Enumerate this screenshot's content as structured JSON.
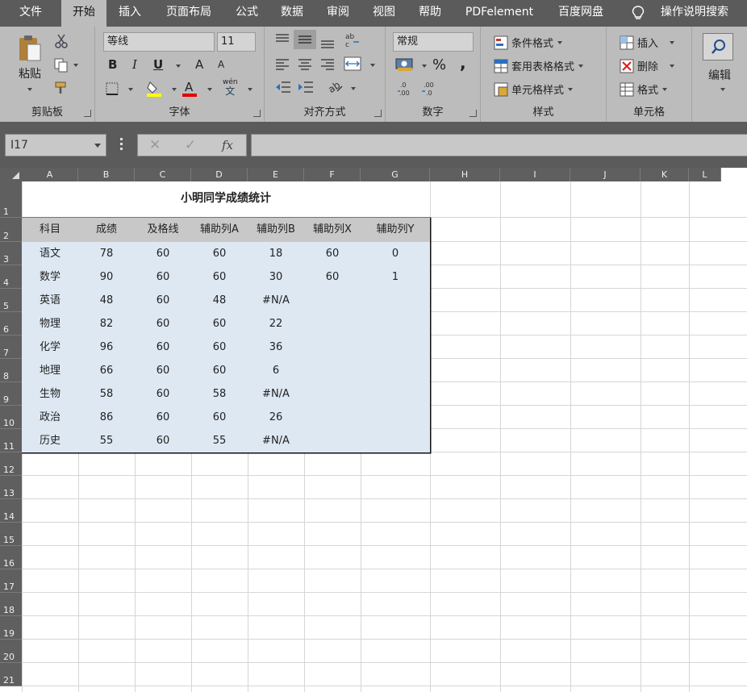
{
  "menu": {
    "tabs": [
      "文件",
      "开始",
      "插入",
      "页面布局",
      "公式",
      "数据",
      "审阅",
      "视图",
      "帮助",
      "PDFelement",
      "百度网盘"
    ],
    "active_tab": "开始",
    "search_label": "操作说明搜索"
  },
  "ribbon": {
    "clipboard": {
      "label": "剪贴板",
      "paste": "粘贴"
    },
    "font": {
      "label": "字体",
      "font_name": "等线",
      "font_size": "11",
      "bold": "B",
      "italic": "I",
      "underline": "U",
      "grow": "A",
      "shrink": "A",
      "phonetic_top": "wén",
      "phonetic_bottom": "文",
      "highlight_color": "#ffff00",
      "font_color": "#e00000"
    },
    "alignment": {
      "label": "对齐方式"
    },
    "number": {
      "label": "数字",
      "format": "常规",
      "percent": "%",
      "comma": ","
    },
    "styles": {
      "label": "样式",
      "conditional": "条件格式",
      "table_format": "套用表格格式",
      "cell_styles": "单元格样式"
    },
    "cells": {
      "label": "单元格",
      "insert": "插入",
      "delete": "删除",
      "format": "格式"
    },
    "editing": {
      "label": "编辑"
    }
  },
  "formula_bar": {
    "name_box": "I17",
    "cancel": "✕",
    "confirm": "✓",
    "fx": "fx",
    "formula": ""
  },
  "sheet": {
    "columns": [
      "A",
      "B",
      "C",
      "D",
      "E",
      "F",
      "G",
      "H",
      "I",
      "J",
      "K",
      "L"
    ],
    "rows": [
      "1",
      "2",
      "3",
      "4",
      "5",
      "6",
      "7",
      "8",
      "9",
      "10",
      "11",
      "12",
      "13",
      "14",
      "15",
      "16",
      "17",
      "18",
      "19",
      "20",
      "21"
    ],
    "title": "小明同学成绩统计",
    "headers": [
      "科目",
      "成绩",
      "及格线",
      "辅助列A",
      "辅助列B",
      "辅助列X",
      "辅助列Y"
    ],
    "data": [
      [
        "语文",
        "78",
        "60",
        "60",
        "18",
        "60",
        "0"
      ],
      [
        "数学",
        "90",
        "60",
        "60",
        "30",
        "60",
        "1"
      ],
      [
        "英语",
        "48",
        "60",
        "48",
        "#N/A",
        "",
        ""
      ],
      [
        "物理",
        "82",
        "60",
        "60",
        "22",
        "",
        ""
      ],
      [
        "化学",
        "96",
        "60",
        "60",
        "36",
        "",
        ""
      ],
      [
        "地理",
        "66",
        "60",
        "60",
        "6",
        "",
        ""
      ],
      [
        "生物",
        "58",
        "60",
        "58",
        "#N/A",
        "",
        ""
      ],
      [
        "政治",
        "86",
        "60",
        "60",
        "26",
        "",
        ""
      ],
      [
        "历史",
        "55",
        "60",
        "55",
        "#N/A",
        "",
        ""
      ]
    ]
  }
}
